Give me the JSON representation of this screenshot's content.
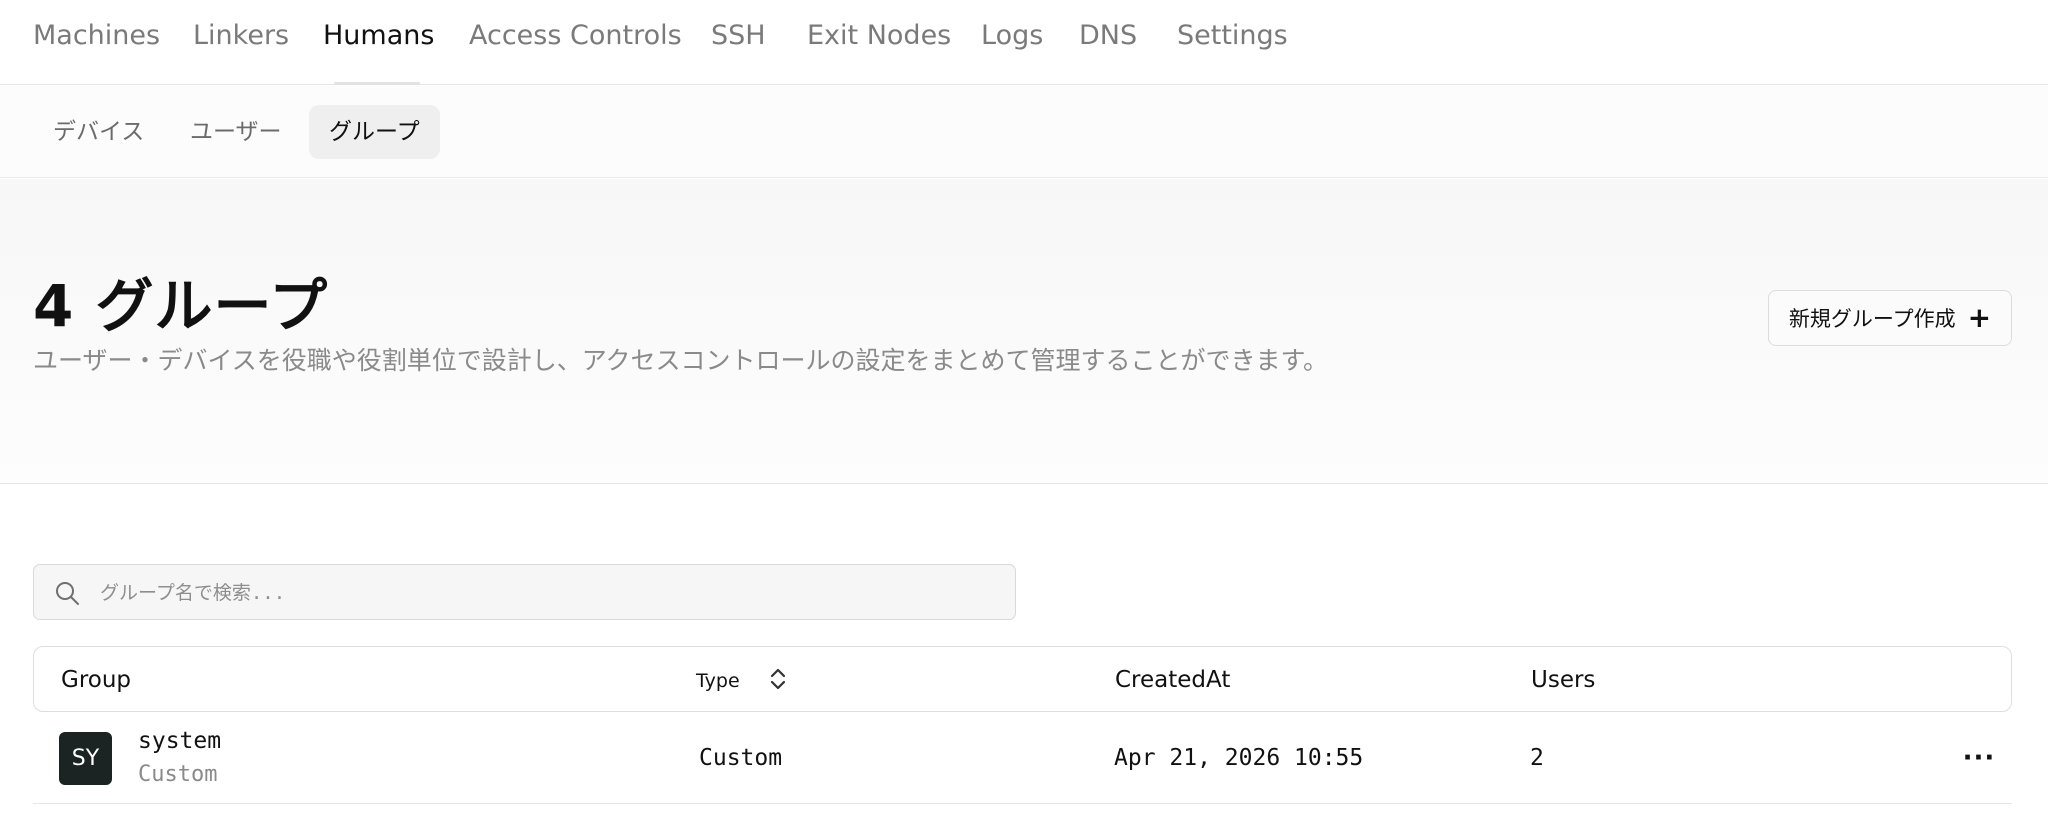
{
  "nav": {
    "tabs": [
      {
        "label": "Machines"
      },
      {
        "label": "Linkers"
      },
      {
        "label": "Humans"
      },
      {
        "label": "Access Controls"
      },
      {
        "label": "SSH"
      },
      {
        "label": "Exit Nodes"
      },
      {
        "label": "Logs"
      },
      {
        "label": "DNS"
      },
      {
        "label": "Settings"
      }
    ],
    "active": "Humans"
  },
  "subnav": {
    "tabs": [
      {
        "label": "デバイス"
      },
      {
        "label": "ユーザー"
      },
      {
        "label": "グループ"
      }
    ],
    "active": "グループ"
  },
  "header": {
    "title": "4 グループ",
    "description": "ユーザー・デバイスを役職や役割単位で設計し、アクセスコントロールの設定をまとめて管理することができます。",
    "create_button": "新規グループ作成",
    "create_icon": "plus-icon"
  },
  "search": {
    "placeholder": "グループ名で検索...",
    "value": "",
    "icon": "search-icon"
  },
  "table": {
    "columns": [
      "Group",
      "Type",
      "CreatedAt",
      "Users"
    ],
    "rows": [
      {
        "avatar": "SY",
        "name": "system",
        "subtitle": "Custom",
        "type": "Custom",
        "created_at": "Apr 21, 2026 10:55",
        "users": "2"
      }
    ]
  },
  "colors": {
    "accent_dark": "#1c2423",
    "muted_text": "#8a8a8a",
    "border": "#dedede"
  }
}
